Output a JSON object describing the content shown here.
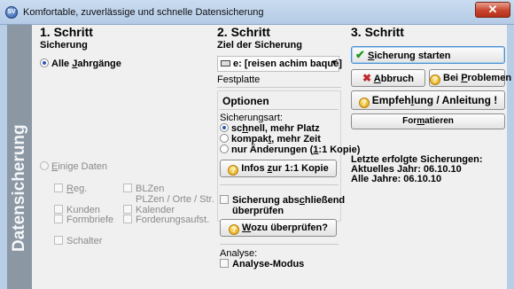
{
  "window": {
    "title": "Komfortable, zuverlässige und schnelle Datensicherung",
    "app_icon_text": "SV",
    "close_glyph": "✕"
  },
  "side_label": "Datensicherung",
  "step1": {
    "heading": "1. Schritt",
    "subheading": "Sicherung",
    "radio_all_prefix": "Alle ",
    "radio_all_key": "J",
    "radio_all_rest": "ahrgänge",
    "radio_some_key": "E",
    "radio_some_rest": "inige Daten",
    "checks_left": [
      {
        "key": "R",
        "rest": "eg."
      },
      {
        "key": "",
        "rest": "Kunden"
      },
      {
        "key": "",
        "rest": "Formbriefe"
      },
      {
        "key": "",
        "rest": "Schalter"
      }
    ],
    "checks_right": [
      {
        "label": "BLZen"
      },
      {
        "label": "PLZen / Orte / Str."
      },
      {
        "label": "Kalender"
      },
      {
        "label": "Forderungsaufst."
      }
    ]
  },
  "step2": {
    "heading": "2. Schritt",
    "subheading": "Ziel der Sicherung",
    "drive_value": "e: [reisen achim baqué]",
    "drive_type": "Festplatte",
    "options_heading": "Optionen",
    "art_label": "Sicherungsart:",
    "art_options": [
      {
        "pre": "sc",
        "key": "h",
        "post": "nell, mehr Platz",
        "selected": true
      },
      {
        "pre": "kompak",
        "key": "t",
        "post": ", mehr Zeit",
        "selected": false
      },
      {
        "pre": "nur Änderungen (",
        "key": "1",
        "post": ":1 Kopie)",
        "selected": false
      }
    ],
    "infos_button_pre": "Infos ",
    "infos_button_key": "z",
    "infos_button_post": "ur 1:1 Kopie",
    "verify_line1_pre": "Sicherung abs",
    "verify_line1_key": "c",
    "verify_line1_post": "hließend",
    "verify_line2": "überprüfen",
    "why_button_key": "W",
    "why_button_post": "ozu überprüfen?",
    "analyse_label": "Analyse:",
    "analyse_mode": "Analyse-Modus"
  },
  "step3": {
    "heading": "3. Schritt",
    "start_button_key": "S",
    "start_button_post": "icherung starten",
    "abort_button_key": "A",
    "abort_button_post": "bbruch",
    "problems_button_pre": "Bei ",
    "problems_button_key": "P",
    "problems_button_post": "roblemen",
    "recommend_pre": "Empfeh",
    "recommend_key": "l",
    "recommend_post": "ung / Anleitung !",
    "format_pre": "For",
    "format_key": "m",
    "format_post": "atieren",
    "last_title": "Letzte erfolgte Sicherungen:",
    "last_current": "Aktuelles Jahr: 06.10.10",
    "last_all": "Alle Jahre: 06.10.10"
  },
  "colors": {
    "side_band": "#8b97a3",
    "title_bar": "#c9dcf0",
    "close_button": "#c8452e",
    "primary_border": "#4d8fcf"
  }
}
